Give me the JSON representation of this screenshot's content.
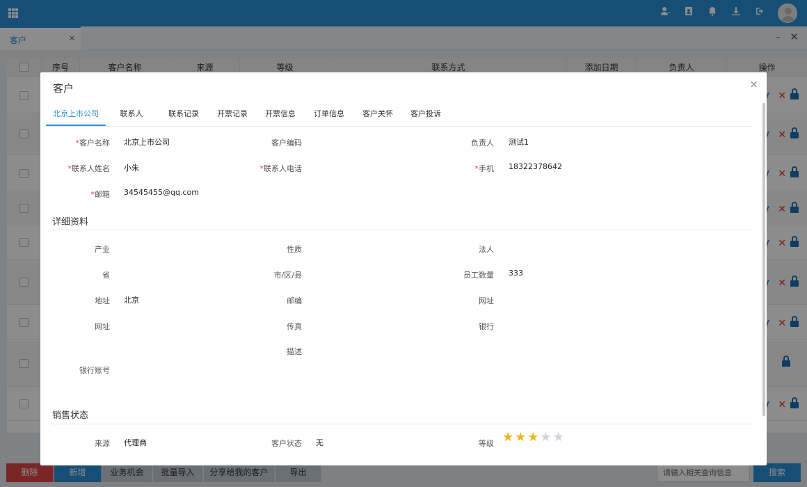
{
  "header": {
    "icons": [
      "user-add-icon",
      "contact-card-icon",
      "bell-icon",
      "download-icon",
      "logout-icon"
    ]
  },
  "tabstrip": {
    "active_tab": "客户",
    "close": "×",
    "minimize": "–",
    "window_close": "✕"
  },
  "table": {
    "headers": [
      "序号",
      "客户名称",
      "来源",
      "等级",
      "联系方式",
      "添加日期",
      "负责人",
      "操作"
    ]
  },
  "bottombar": {
    "delete": "删除",
    "add": "新增",
    "opportunity": "业务机会",
    "import": "批量导入",
    "shared": "分享给我的客户",
    "export": "导出",
    "search_placeholder": "请输入相关查询信息",
    "search": "搜索"
  },
  "modal": {
    "title": "客户",
    "close": "×",
    "tabs": [
      "北京上市公司",
      "联系人",
      "联系记录",
      "开票记录",
      "开票信息",
      "订单信息",
      "客户关怀",
      "客户投诉"
    ],
    "basic": {
      "customer_name_label": "客户名称",
      "customer_name": "北京上市公司",
      "customer_code_label": "客户编码",
      "owner_label": "负责人",
      "owner": "测试1",
      "contact_name_label": "联系人姓名",
      "contact_name": "小朱",
      "contact_phone_label": "联系人电话",
      "mobile_label": "手机",
      "mobile": "18322378642",
      "email_label": "邮箱",
      "email": "34545455@qq.com"
    },
    "detail_section": "详细资料",
    "detail": {
      "industry_label": "产业",
      "nature_label": "性质",
      "legal_label": "法人",
      "province_label": "省",
      "city_label": "市/区/县",
      "staff_label": "员工数量",
      "staff": "333",
      "address_label": "地址",
      "address": "北京",
      "zip_label": "邮编",
      "website_label": "网址",
      "website2_label": "网址",
      "fax_label": "传真",
      "bank_label": "银行",
      "desc_label": "描述",
      "bank_account_label": "银行账号"
    },
    "sales_section": "销售状态",
    "sales": {
      "source_label": "来源",
      "source": "代理商",
      "status_label": "客户状态",
      "status": "无",
      "level_label": "等级",
      "level_stars": 3,
      "level_max": 5
    }
  },
  "colors": {
    "accent": "#2b8fd6",
    "danger": "#e04545",
    "star": "#f2b41a"
  }
}
